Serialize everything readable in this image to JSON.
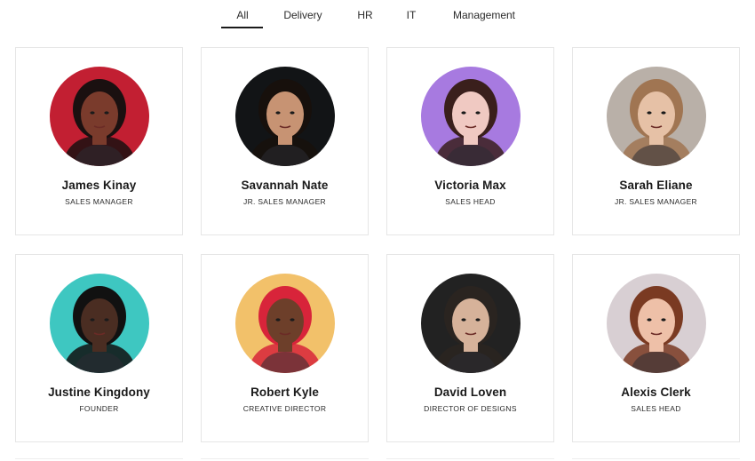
{
  "filters": {
    "tabs": [
      {
        "label": "All",
        "active": true
      },
      {
        "label": "Delivery",
        "active": false
      },
      {
        "label": "HR",
        "active": false
      },
      {
        "label": "IT",
        "active": false
      },
      {
        "label": "Management",
        "active": false
      }
    ]
  },
  "team": [
    {
      "name": "James Kinay",
      "role": "SALES MANAGER",
      "photo": "avatar-photo",
      "bg": "#c21f32",
      "skin": "#7a3b2c",
      "hair": "#1a1010"
    },
    {
      "name": "Savannah Nate",
      "role": "JR. SALES MANAGER",
      "photo": "avatar-photo",
      "bg": "#121416",
      "skin": "#c79373",
      "hair": "#17100c"
    },
    {
      "name": "Victoria Max",
      "role": "SALES HEAD",
      "photo": "avatar-photo",
      "bg": "#a77ae0",
      "skin": "#f0c9c2",
      "hair": "#3a1f1c"
    },
    {
      "name": "Sarah Eliane",
      "role": "JR. SALES MANAGER",
      "photo": "avatar-photo",
      "bg": "#b9b0a8",
      "skin": "#e6c1a6",
      "hair": "#a07552"
    },
    {
      "name": "Justine Kingdony",
      "role": "FOUNDER",
      "photo": "avatar-photo",
      "bg": "#3ec7c1",
      "skin": "#4a2d22",
      "hair": "#111111"
    },
    {
      "name": "Robert Kyle",
      "role": "CREATIVE DIRECTOR",
      "photo": "avatar-photo",
      "bg": "#f2c16a",
      "skin": "#6d3f2a",
      "hair": "#d8243a"
    },
    {
      "name": "David Loven",
      "role": "DIRECTOR OF DESIGNS",
      "photo": "avatar-photo",
      "bg": "#222222",
      "skin": "#d6b29a",
      "hair": "#2a2420"
    },
    {
      "name": "Alexis Clerk",
      "role": "SALES HEAD",
      "photo": "avatar-photo",
      "bg": "#d8cfd3",
      "skin": "#eec0a8",
      "hair": "#7a3a22"
    }
  ]
}
